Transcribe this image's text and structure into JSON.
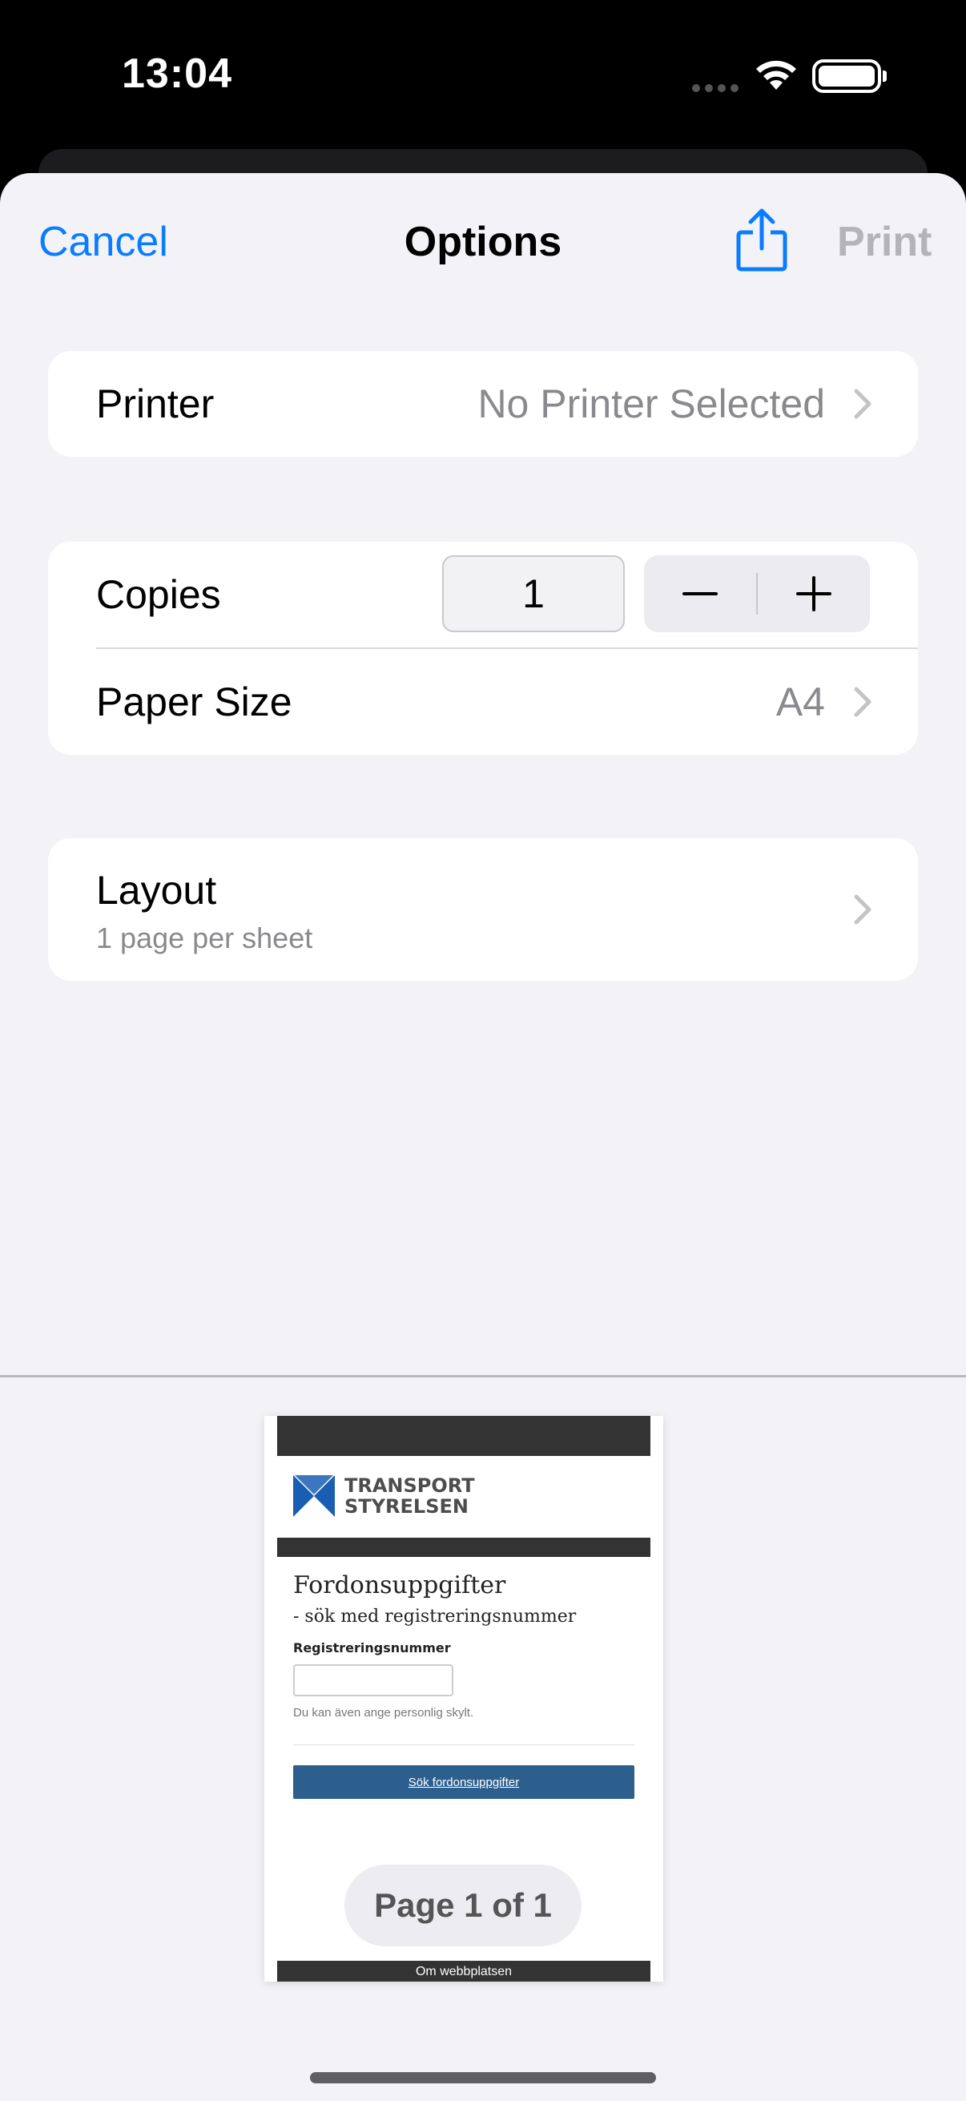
{
  "status_bar": {
    "time": "13:04"
  },
  "nav": {
    "cancel_label": "Cancel",
    "title": "Options",
    "share_icon": "share-icon",
    "print_label": "Print"
  },
  "printer_row": {
    "label": "Printer",
    "value": "No Printer Selected"
  },
  "copies_row": {
    "label": "Copies",
    "value": "1",
    "decrement_symbol": "minus-icon",
    "increment_symbol": "plus-icon"
  },
  "paper_size_row": {
    "label": "Paper Size",
    "value": "A4"
  },
  "layout_row": {
    "label": "Layout",
    "value": "1 page per sheet"
  },
  "preview": {
    "logo_text_line1": "TRANSPORT",
    "logo_text_line2": "STYRELSEN",
    "heading": "Fordonsuppgifter",
    "subheading": "- sök med registreringsnummer",
    "field_label": "Registreringsnummer",
    "hint": "Du kan även ange personlig skylt.",
    "button_label": "Sök fordonsuppgifter",
    "footer_text": "Om webbplatsen",
    "page_badge": "Page 1 of 1"
  },
  "colors": {
    "accent": "#0a7cff",
    "disabled": "#b4b4b8",
    "background": "#f2f2f7",
    "preview_button": "#2d5f8e",
    "logo_blue": "#1a5eb3"
  }
}
